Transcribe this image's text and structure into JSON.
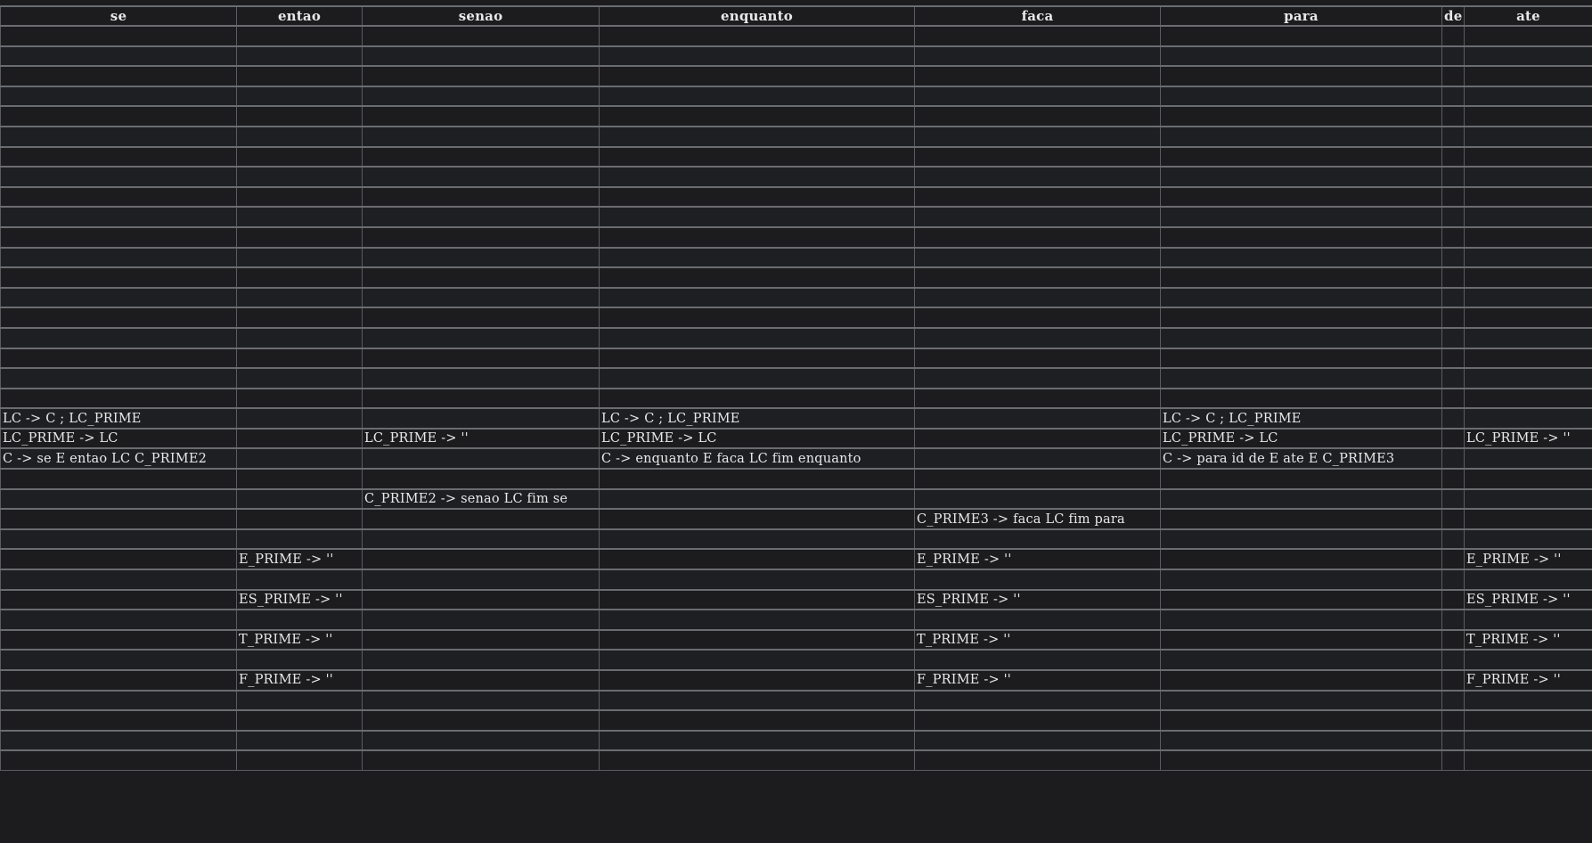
{
  "columns": [
    "se",
    "entao",
    "senao",
    "enquanto",
    "faca",
    "para",
    "de",
    "ate"
  ],
  "rows": [
    [
      "",
      "",
      "",
      "",
      "",
      "",
      "",
      ""
    ],
    [
      "",
      "",
      "",
      "",
      "",
      "",
      "",
      ""
    ],
    [
      "",
      "",
      "",
      "",
      "",
      "",
      "",
      ""
    ],
    [
      "",
      "",
      "",
      "",
      "",
      "",
      "",
      ""
    ],
    [
      "",
      "",
      "",
      "",
      "",
      "",
      "",
      ""
    ],
    [
      "",
      "",
      "",
      "",
      "",
      "",
      "",
      ""
    ],
    [
      "",
      "",
      "",
      "",
      "",
      "",
      "",
      ""
    ],
    [
      "",
      "",
      "",
      "",
      "",
      "",
      "",
      ""
    ],
    [
      "",
      "",
      "",
      "",
      "",
      "",
      "",
      ""
    ],
    [
      "",
      "",
      "",
      "",
      "",
      "",
      "",
      ""
    ],
    [
      "",
      "",
      "",
      "",
      "",
      "",
      "",
      ""
    ],
    [
      "",
      "",
      "",
      "",
      "",
      "",
      "",
      ""
    ],
    [
      "",
      "",
      "",
      "",
      "",
      "",
      "",
      ""
    ],
    [
      "",
      "",
      "",
      "",
      "",
      "",
      "",
      ""
    ],
    [
      "",
      "",
      "",
      "",
      "",
      "",
      "",
      ""
    ],
    [
      "",
      "",
      "",
      "",
      "",
      "",
      "",
      ""
    ],
    [
      "",
      "",
      "",
      "",
      "",
      "",
      "",
      ""
    ],
    [
      "",
      "",
      "",
      "",
      "",
      "",
      "",
      ""
    ],
    [
      "",
      "",
      "",
      "",
      "",
      "",
      "",
      ""
    ],
    [
      "LC -> C ; LC_PRIME",
      "",
      "",
      "LC -> C ; LC_PRIME",
      "",
      "LC -> C ; LC_PRIME",
      "",
      ""
    ],
    [
      "LC_PRIME -> LC",
      "",
      "LC_PRIME -> ''",
      "LC_PRIME -> LC",
      "",
      "LC_PRIME -> LC",
      "",
      "LC_PRIME -> ''"
    ],
    [
      "C -> se E entao LC C_PRIME2",
      "",
      "",
      "C -> enquanto E faca LC fim enquanto",
      "",
      "C -> para id de E ate E C_PRIME3",
      "",
      ""
    ],
    [
      "",
      "",
      "",
      "",
      "",
      "",
      "",
      ""
    ],
    [
      "",
      "",
      "C_PRIME2 -> senao LC fim se",
      "",
      "",
      "",
      "",
      ""
    ],
    [
      "",
      "",
      "",
      "",
      "C_PRIME3 -> faca LC fim para",
      "",
      "",
      ""
    ],
    [
      "",
      "",
      "",
      "",
      "",
      "",
      "",
      ""
    ],
    [
      "",
      "E_PRIME -> ''",
      "",
      "",
      "E_PRIME -> ''",
      "",
      "",
      "E_PRIME -> ''"
    ],
    [
      "",
      "",
      "",
      "",
      "",
      "",
      "",
      ""
    ],
    [
      "",
      "ES_PRIME -> ''",
      "",
      "",
      "ES_PRIME -> ''",
      "",
      "",
      "ES_PRIME -> ''"
    ],
    [
      "",
      "",
      "",
      "",
      "",
      "",
      "",
      ""
    ],
    [
      "",
      "T_PRIME -> ''",
      "",
      "",
      "T_PRIME -> ''",
      "",
      "",
      "T_PRIME -> ''"
    ],
    [
      "",
      "",
      "",
      "",
      "",
      "",
      "",
      ""
    ],
    [
      "",
      "F_PRIME -> ''",
      "",
      "",
      "F_PRIME -> ''",
      "",
      "",
      "F_PRIME -> ''"
    ],
    [
      "",
      "",
      "",
      "",
      "",
      "",
      "",
      ""
    ],
    [
      "",
      "",
      "",
      "",
      "",
      "",
      "",
      ""
    ],
    [
      "",
      "",
      "",
      "",
      "",
      "",
      "",
      ""
    ],
    [
      "",
      "",
      "",
      "",
      "",
      "",
      "",
      ""
    ]
  ]
}
